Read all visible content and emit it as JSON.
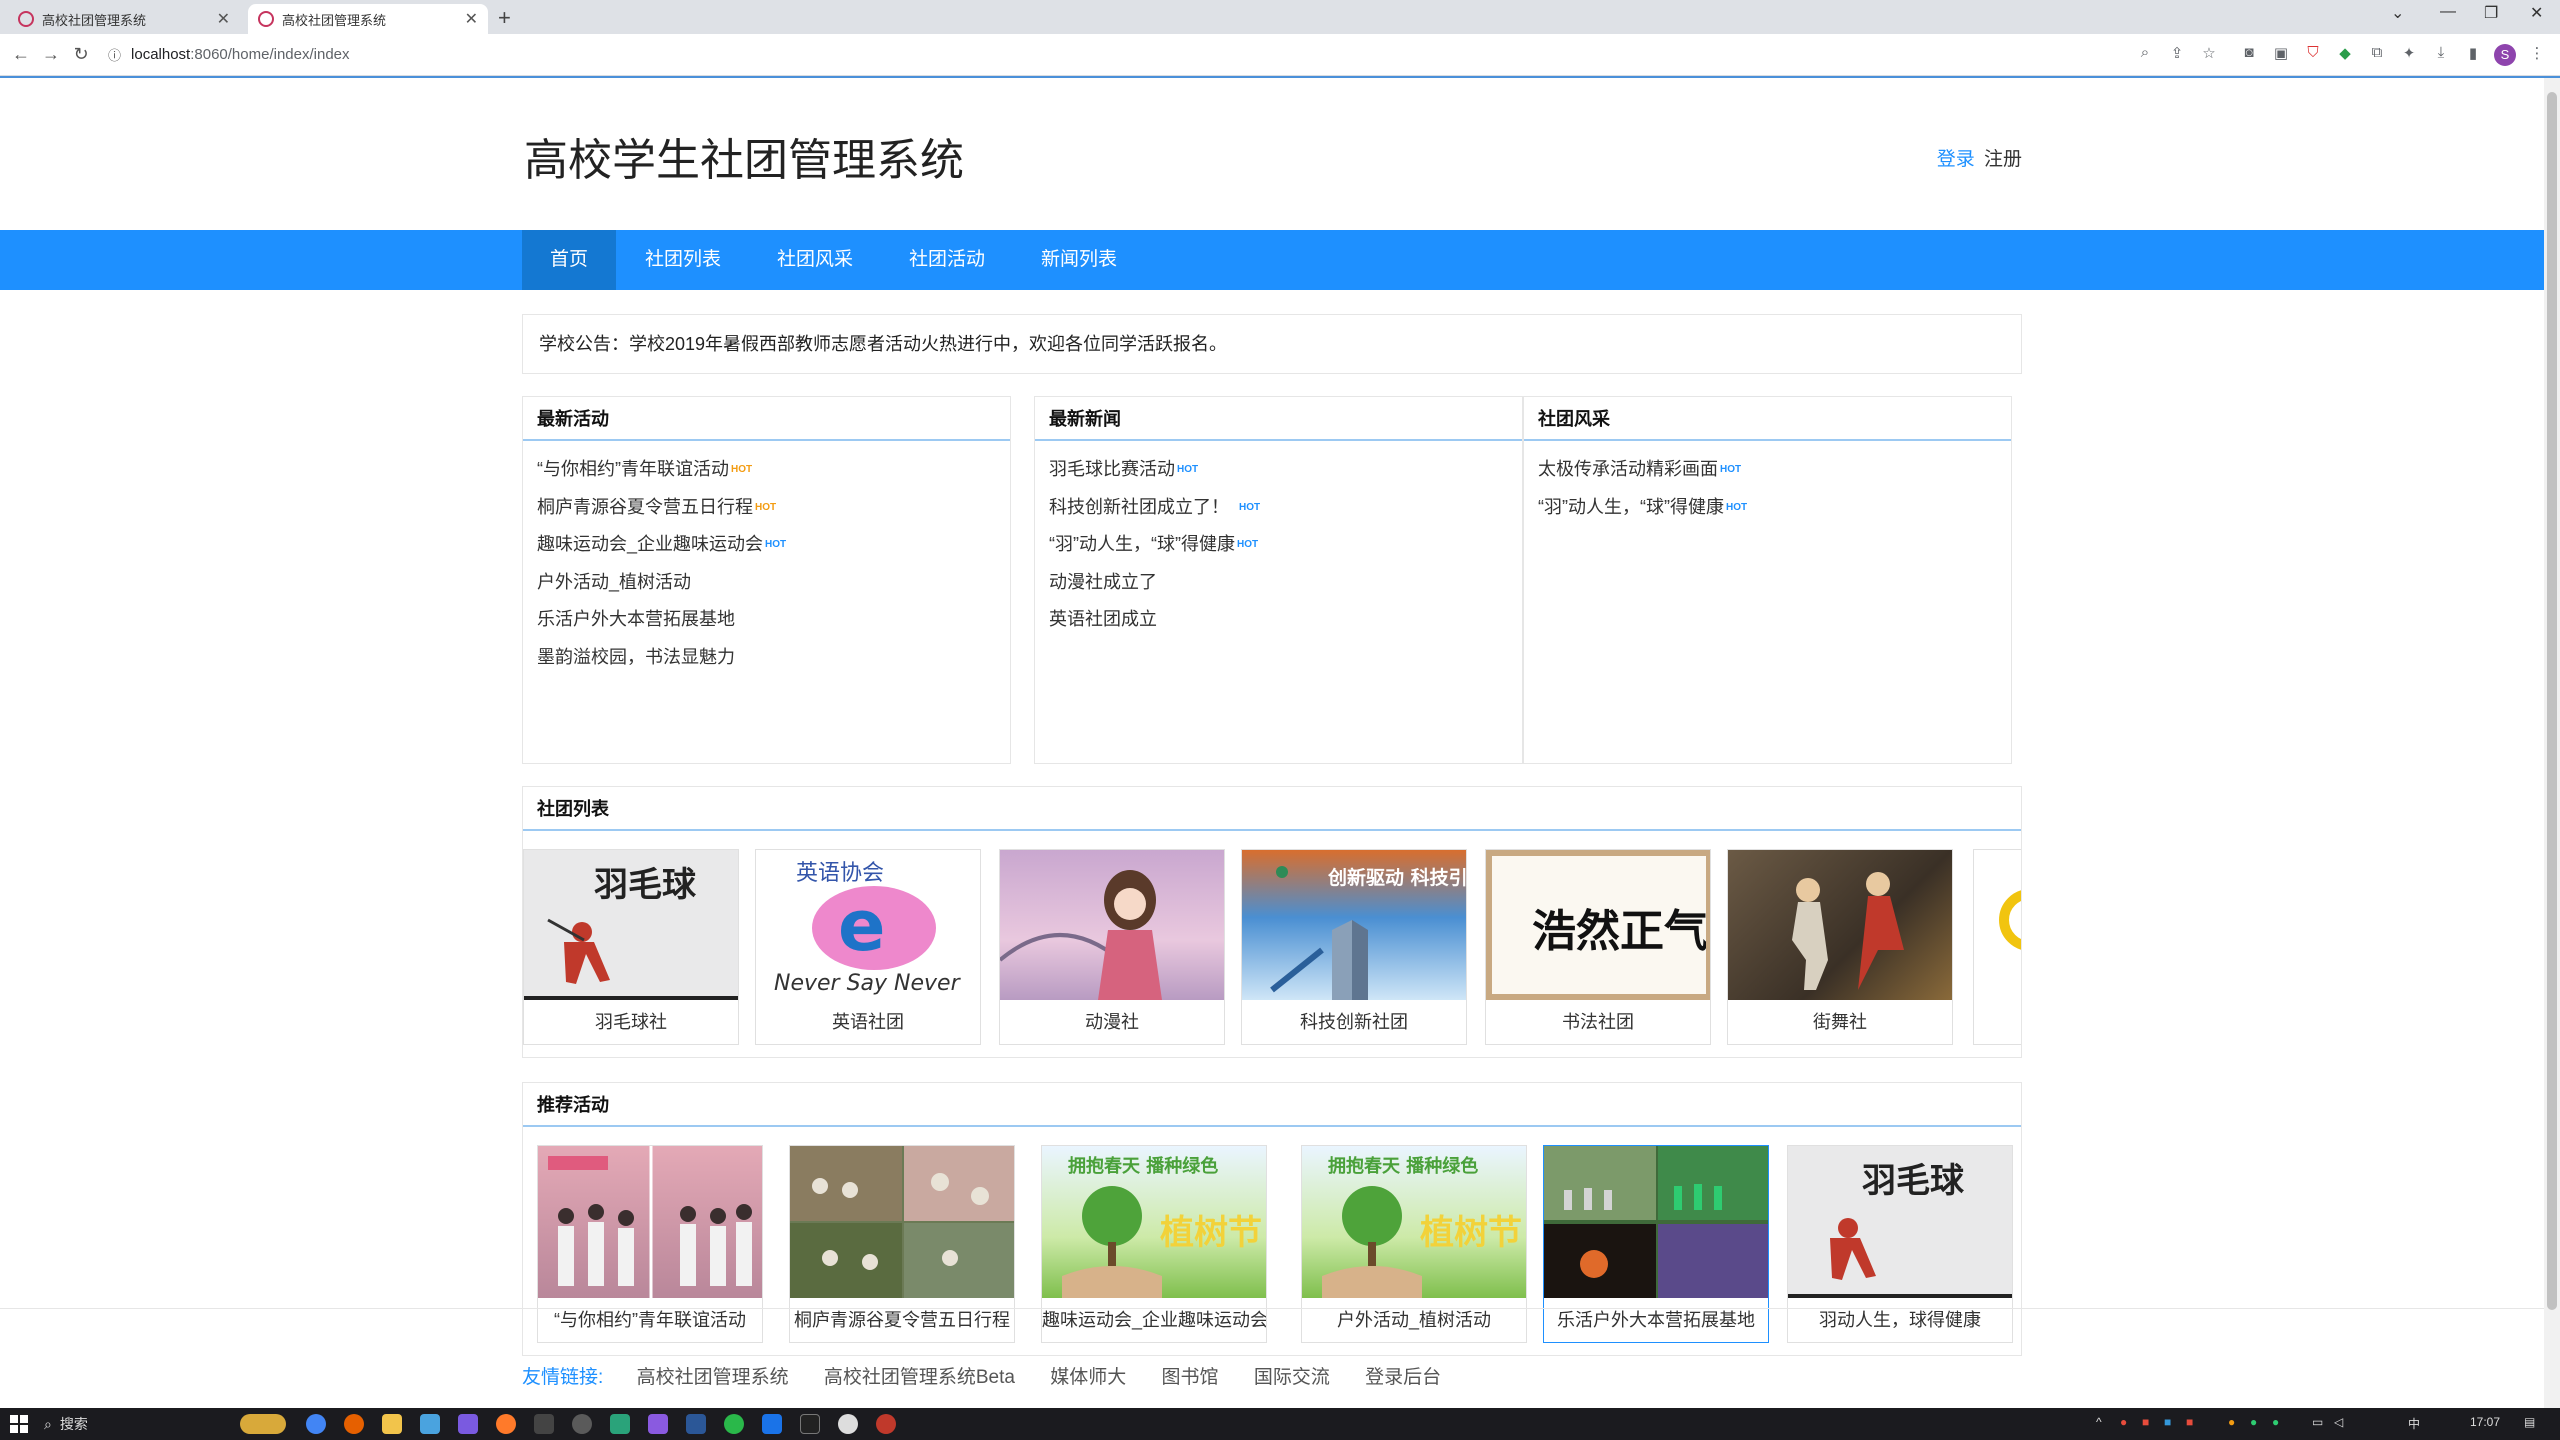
{
  "browser": {
    "tabs": [
      {
        "title": "高校社团管理系统",
        "active": false
      },
      {
        "title": "高校社团管理系统",
        "active": true
      }
    ],
    "url_host": "localhost",
    "url_path": ":8060/home/index/index",
    "profile_initial": "S"
  },
  "header": {
    "site_title": "高校学生社团管理系统",
    "login": "登录",
    "register": "注册"
  },
  "nav": [
    "首页",
    "社团列表",
    "社团风采",
    "社团活动",
    "新闻列表"
  ],
  "notice": "学校公告：学校2019年暑假西部教师志愿者活动火热进行中，欢迎各位同学活跃报名。",
  "panels": [
    {
      "title": "最新活动",
      "hot_color": "orange",
      "items": [
        {
          "text": "“与你相约”青年联谊活动",
          "hot": true
        },
        {
          "text": "桐庐青源谷夏令营五日行程",
          "hot": true
        },
        {
          "text": "趣味运动会_企业趣味运动会",
          "hot": true
        },
        {
          "text": "户外活动_植树活动",
          "hot": false
        },
        {
          "text": "乐活户外大本营拓展基地",
          "hot": false
        },
        {
          "text": "墨韵溢校园，书法显魅力",
          "hot": false
        }
      ]
    },
    {
      "title": "最新新闻",
      "hot_color": "blue",
      "items": [
        {
          "text": "羽毛球比赛活动",
          "hot": true
        },
        {
          "text": "科技创新社团成立了！",
          "hot": true
        },
        {
          "text": "“羽”动人生，“球”得健康",
          "hot": true
        },
        {
          "text": "动漫社成立了",
          "hot": false
        },
        {
          "text": "英语社团成立",
          "hot": false
        }
      ]
    },
    {
      "title": "社团风采",
      "hot_color": "blue",
      "items": [
        {
          "text": "太极传承活动精彩画面",
          "hot": true
        },
        {
          "text": "“羽”动人生，“球”得健康",
          "hot": true
        }
      ]
    }
  ],
  "hot_label": "HOT",
  "clubs": {
    "title": "社团列表",
    "items": [
      {
        "name": "羽毛球社",
        "bg": "#e9e9ea"
      },
      {
        "name": "英语社团",
        "bg": "#ffffff"
      },
      {
        "name": "动漫社",
        "bg": "#d9b8d8"
      },
      {
        "name": "科技创新社团",
        "bg": "#2e6fb5"
      },
      {
        "name": "书法社团",
        "bg": "#f4efe4"
      },
      {
        "name": "街舞社",
        "bg": "#5a4a3a"
      }
    ],
    "img_texts": {
      "badminton": "羽毛球",
      "english": "英语协会",
      "english_slogan": "Never Say Never",
      "tech": "创新驱动 科技引领",
      "calligraphy": "浩然正气"
    }
  },
  "recommended": {
    "title": "推荐活动",
    "items": [
      {
        "name": "“与你相约”青年联谊活动",
        "bg": "#c98a9a"
      },
      {
        "name": "桐庐青源谷夏令营五日行程",
        "bg": "#6b7a55"
      },
      {
        "name": "趣味运动会_企业趣味运动会",
        "bg": "#7fbf4d"
      },
      {
        "name": "户外活动_植树活动",
        "bg": "#7fbf4d"
      },
      {
        "name": "乐活户外大本营拓展基地",
        "bg": "#3f6a3a"
      },
      {
        "name": "羽动人生，球得健康",
        "bg": "#e9e9ea"
      }
    ],
    "img_texts": {
      "tree_banner": "拥抱春天 播种绿色",
      "tree_day": "植树节"
    }
  },
  "footer": {
    "label": "友情链接:",
    "links": [
      "高校社团管理系统",
      "高校社团管理系统Beta",
      "媒体师大",
      "图书馆",
      "国际交流",
      "登录后台"
    ]
  },
  "taskbar": {
    "search": "搜索",
    "time": "17:07",
    "ime": "中"
  }
}
